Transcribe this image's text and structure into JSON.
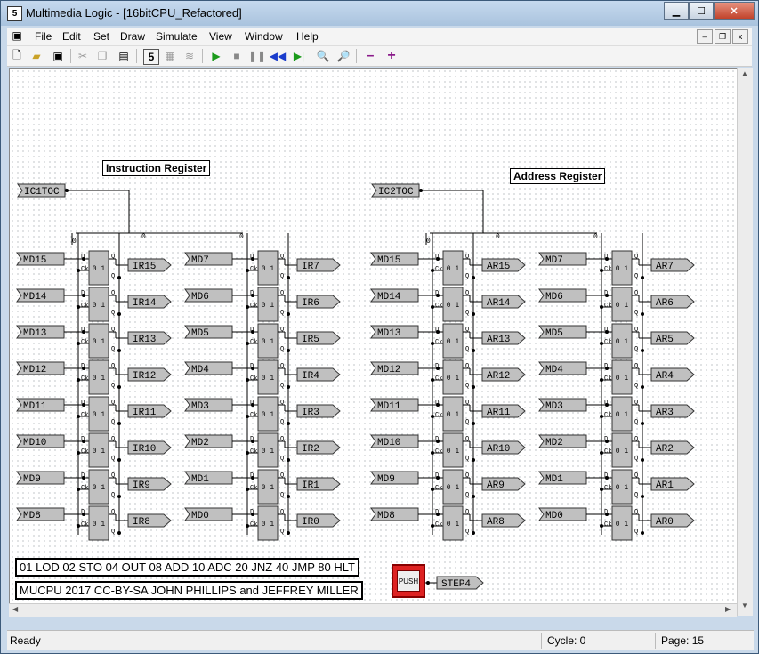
{
  "window": {
    "title": "Multimedia Logic - [16bitCPU_Refactored]",
    "app_icon": "5"
  },
  "window_buttons": {
    "minimize": "▁",
    "maximize": "☐",
    "close": "✕"
  },
  "mdi_buttons": {
    "minimize": "–",
    "restore": "❐",
    "close": "x"
  },
  "menu": [
    "File",
    "Edit",
    "Set",
    "Draw",
    "Simulate",
    "View",
    "Window",
    "Help"
  ],
  "toolbar": [
    "new-icon",
    "open-icon",
    "save-icon",
    "cut-icon",
    "copy-icon",
    "paste-icon",
    "edit-mode-icon",
    "simulate-mode-icon",
    "step-mode-icon",
    "run-icon",
    "stop-icon",
    "pause-icon",
    "rewind-icon",
    "step-icon",
    "zoom-out-icon",
    "zoom-in-icon",
    "minus-icon",
    "plus-icon"
  ],
  "labels": {
    "ir_title": "Instruction Register",
    "ar_title": "Address Register"
  },
  "ir_clock": "IC1TOC",
  "ar_clock": "IC2TOC",
  "ir_high_inputs": [
    "MD15",
    "MD14",
    "MD13",
    "MD12",
    "MD11",
    "MD10",
    "MD9",
    "MD8"
  ],
  "ir_high_outputs": [
    "IR15",
    "IR14",
    "IR13",
    "IR12",
    "IR11",
    "IR10",
    "IR9",
    "IR8"
  ],
  "ir_low_inputs": [
    "MD7",
    "MD6",
    "MD5",
    "MD4",
    "MD3",
    "MD2",
    "MD1",
    "MD0"
  ],
  "ir_low_outputs": [
    "IR7",
    "IR6",
    "IR5",
    "IR4",
    "IR3",
    "IR2",
    "IR1",
    "IR0"
  ],
  "ar_high_inputs": [
    "MD15",
    "MD14",
    "MD13",
    "MD12",
    "MD11",
    "MD10",
    "MD9",
    "MD8"
  ],
  "ar_high_outputs": [
    "AR15",
    "AR14",
    "AR13",
    "AR12",
    "AR11",
    "AR10",
    "AR9",
    "AR8"
  ],
  "ar_low_inputs": [
    "MD7",
    "MD6",
    "MD5",
    "MD4",
    "MD3",
    "MD2",
    "MD1",
    "MD0"
  ],
  "ar_low_outputs": [
    "AR7",
    "AR6",
    "AR5",
    "AR4",
    "AR3",
    "AR2",
    "AR1",
    "AR0"
  ],
  "ff_labels": {
    "d": "D",
    "ck": "Ck",
    "q": "Q",
    "nq": "Q",
    "state": "0 1",
    "set": "0",
    "reset": "0"
  },
  "opcodes": "01 LOD 02 STO 04 OUT 08 ADD 10 ADC 20 JNZ 40 JMP 80 HLT",
  "credits": "MUCPU 2017 CC-BY-SA JOHN PHILLIPS and JEFFREY MILLER",
  "push_button": {
    "label": "PUSH",
    "color": "#dd2222"
  },
  "push_output": "STEP4",
  "status": {
    "ready": "Ready",
    "cycle": "Cycle: 0",
    "page": "Page: 15"
  },
  "colors": {
    "wire": "#000000",
    "component_fill": "#c0c0c0"
  }
}
